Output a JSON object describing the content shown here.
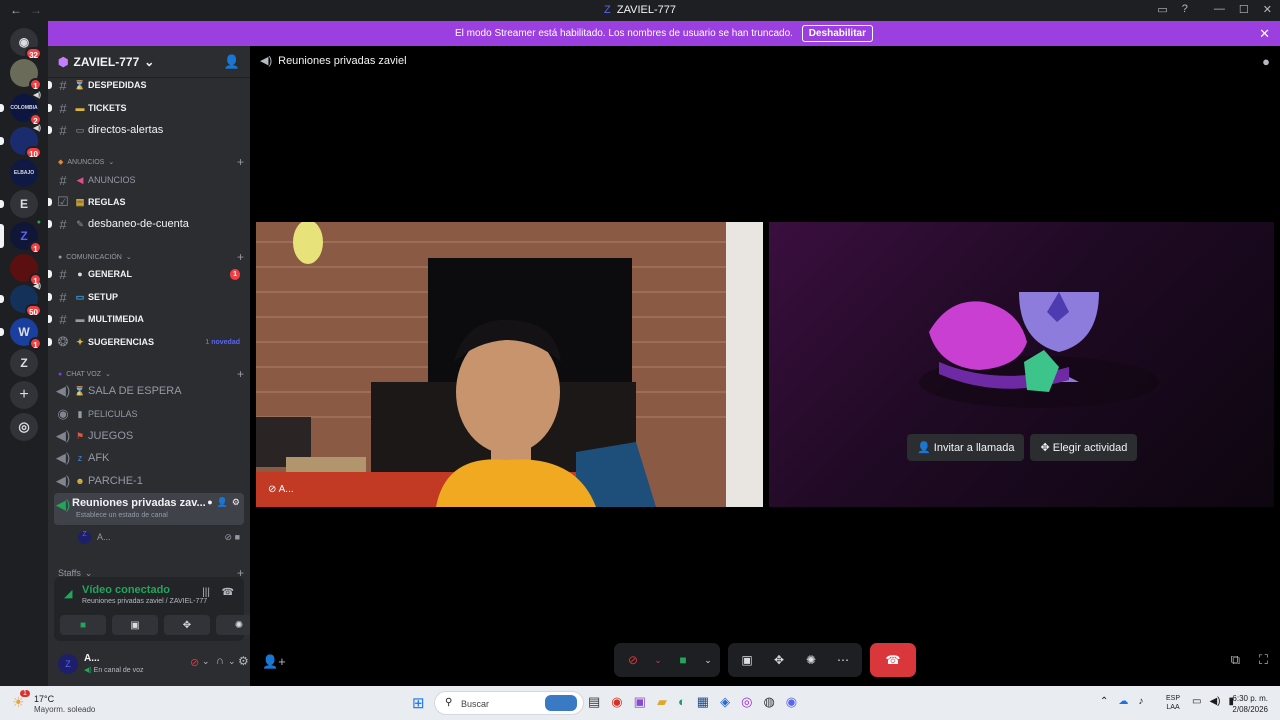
{
  "window": {
    "title": "ZAVIEL-777"
  },
  "banner": {
    "text": "El modo Streamer está habilitado. Los nombres de usuario se han truncado.",
    "button": "Deshabilitar"
  },
  "rail": {
    "badges": [
      "32",
      "1",
      "2",
      "10",
      "1",
      "1",
      "50",
      "1"
    ],
    "letters": [
      "E",
      "Z"
    ]
  },
  "server": {
    "name": "ZAVIEL-777"
  },
  "channels": {
    "despedidas": "DESPEDIDAS",
    "tickets": "TICKETS",
    "directos": "directos-alertas",
    "cat_anuncios": "ANUNCIOS",
    "anuncios": "ANUNCIOS",
    "reglas": "REGLAS",
    "desbaneo": "desbaneo-de-cuenta",
    "cat_comunicacion": "COMUNICACIÓN",
    "general": "GENERAL",
    "general_badge": "1",
    "setup": "SETUP",
    "multimedia": "MULTIMEDIA",
    "sugerencias": "SUGERENCIAS",
    "sugerencias_badge": "1 novedad",
    "cat_chatvoz": "CHAT VOZ",
    "sala": "SALA DE ESPERA",
    "peliculas": "PELICULAS",
    "juegos": "JUEGOS",
    "afk": "AFK",
    "parche": "PARCHE-1",
    "reuniones": "Reuniones privadas zav...",
    "reuniones_status": "Establece un estado de canal",
    "member": "A...",
    "cat_staffs": "Staffs"
  },
  "voice_panel": {
    "status": "Vídeo conectado",
    "location": "Reuniones privadas zaviel / ZAVIEL-777"
  },
  "user": {
    "name": "A...",
    "status": "En canal de voz"
  },
  "main": {
    "channel_title": "Reuniones privadas zaviel",
    "video_label": "A...",
    "invite_button": "Invitar a llamada",
    "activity_button": "Elegir actividad"
  },
  "taskbar": {
    "weather_temp": "17°C",
    "weather_desc": "Mayorm. soleado",
    "weather_badge": "1",
    "search": "Buscar",
    "lang": "ESP",
    "region": "LAA",
    "time": "6:30 p. m.",
    "date": "2/08/2026"
  },
  "colors": {
    "accent": "#5865f2",
    "banner": "#9b3fe0",
    "connected": "#23a55a",
    "danger": "#da373c"
  }
}
